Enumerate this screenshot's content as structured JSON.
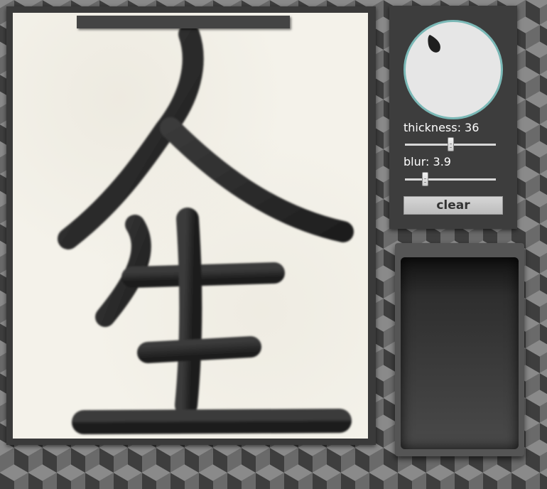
{
  "controls": {
    "thickness_label": "thickness: 36",
    "thickness_value": 36,
    "thickness_fraction": 0.5,
    "blur_label": "blur: 3.9",
    "blur_value": 3.9,
    "blur_fraction": 0.22,
    "clear_label": "clear"
  },
  "colors": {
    "ink": "#2a2a2a",
    "paper": "#f4f2ea",
    "preview_ring": "#7ab8b6"
  }
}
